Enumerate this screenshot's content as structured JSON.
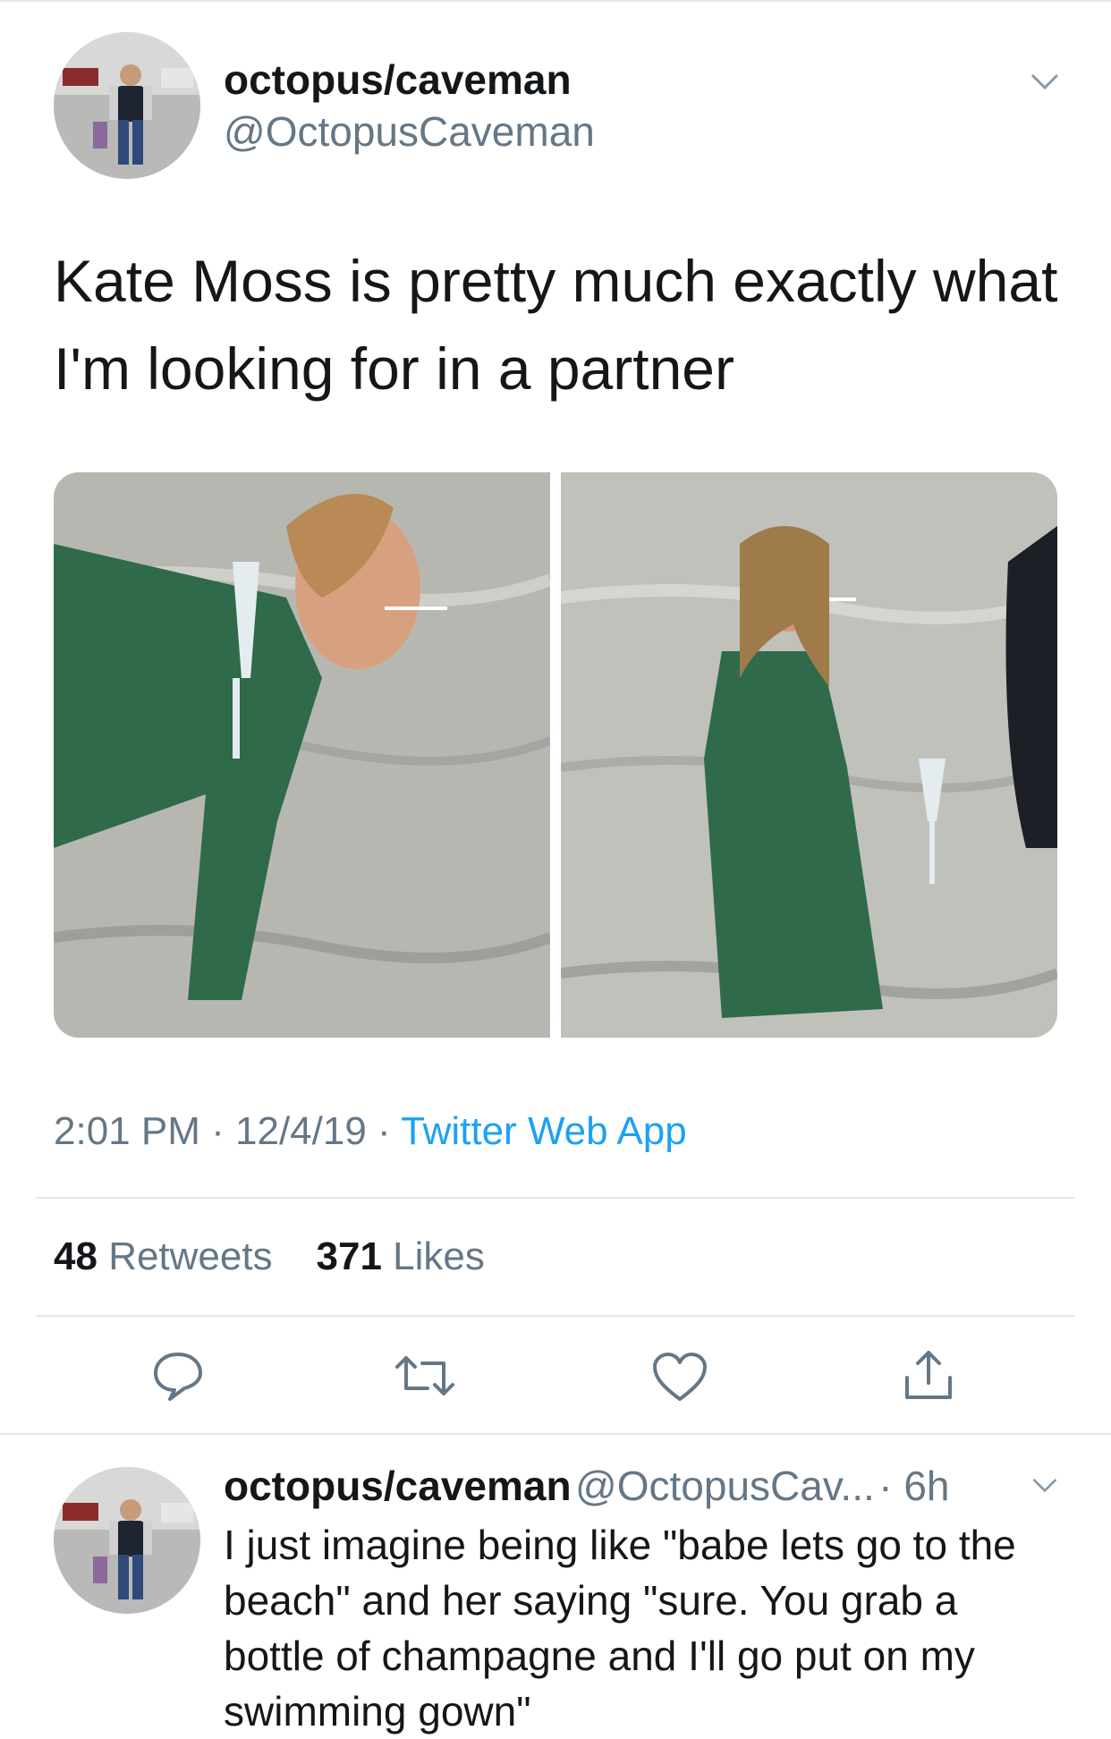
{
  "tweet": {
    "author": {
      "display_name": "octopus/caveman",
      "handle": "@OctopusCaveman",
      "avatar_icon": "avatar-photo"
    },
    "more_icon": "chevron-down-icon",
    "text": "Kate Moss is pretty much exactly what I'm looking for in a partner",
    "media": [
      {
        "icon": "photo-woman-leaning-in-water"
      },
      {
        "icon": "photo-woman-standing-in-water"
      }
    ],
    "meta": {
      "time": "2:01 PM",
      "separator": "·",
      "date": "12/4/19",
      "source": "Twitter Web App"
    },
    "stats": {
      "retweets_count": "48",
      "retweets_label": "Retweets",
      "likes_count": "371",
      "likes_label": "Likes"
    },
    "actions": [
      {
        "icon": "reply-icon"
      },
      {
        "icon": "retweet-icon"
      },
      {
        "icon": "like-icon"
      },
      {
        "icon": "share-icon"
      }
    ]
  },
  "reply": {
    "author": {
      "display_name": "octopus/caveman",
      "handle": "@OctopusCav...",
      "time": "· 6h"
    },
    "text": "I just imagine being like \"babe lets go to the beach\" and her saying \"sure. You grab a bottle of champagne and I'll go put on my swimming gown\""
  },
  "colors": {
    "text": "#14171a",
    "secondary": "#657786",
    "link": "#1da1f2",
    "divider": "#e1e8ed"
  }
}
